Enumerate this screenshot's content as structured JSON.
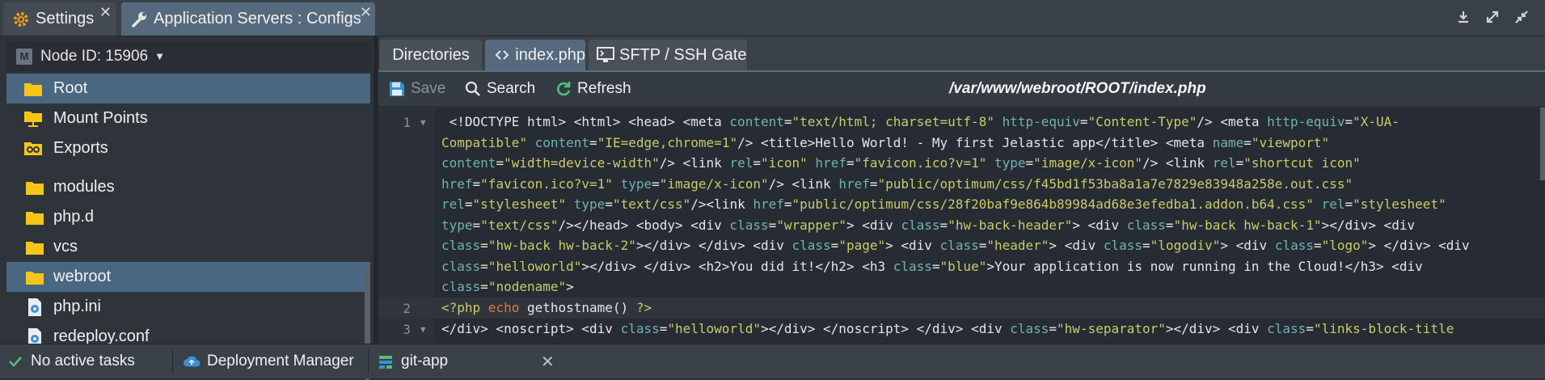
{
  "window_tabs": [
    {
      "label": "Settings",
      "icon": "gear-icon"
    },
    {
      "label": "Application Servers : Configs",
      "icon": "wrench-icon"
    }
  ],
  "node_selector": {
    "label": "Node ID: 15906",
    "badge": "M"
  },
  "tree": [
    {
      "label": "Root",
      "icon": "folder-icon"
    },
    {
      "label": "Mount Points",
      "icon": "mount-folder-icon"
    },
    {
      "label": "Exports",
      "icon": "exports-icon"
    },
    {
      "label": "modules",
      "icon": "folder-icon"
    },
    {
      "label": "php.d",
      "icon": "folder-icon"
    },
    {
      "label": "vcs",
      "icon": "folder-icon"
    },
    {
      "label": "webroot",
      "icon": "folder-icon"
    },
    {
      "label": "php.ini",
      "icon": "config-file-icon"
    },
    {
      "label": "redeploy.conf",
      "icon": "config-file-icon"
    }
  ],
  "editor_tabs": [
    {
      "label": "Directories"
    },
    {
      "label": "index.php"
    },
    {
      "label": "SFTP / SSH Gate"
    }
  ],
  "toolbar": {
    "save": "Save",
    "search": "Search",
    "refresh": "Refresh",
    "path": "/var/www/webroot/ROOT/index.php"
  },
  "code": {
    "line_numbers": [
      "1",
      "2",
      "3"
    ],
    "line1": [
      [
        [
          "t",
          " <!DOCTYPE html> <html> <head> <meta "
        ],
        [
          "a",
          "content"
        ],
        [
          "p",
          "="
        ],
        [
          "s",
          "\"text/html; charset=utf-8\""
        ],
        [
          "p",
          " "
        ],
        [
          "a",
          "http-equiv"
        ],
        [
          "p",
          "="
        ],
        [
          "s",
          "\"Content-Type\""
        ],
        [
          "t",
          "/> <meta "
        ],
        [
          "a",
          "http-equiv"
        ],
        [
          "p",
          "="
        ],
        [
          "s",
          "\"X-UA-"
        ]
      ],
      [
        [
          "s",
          "Compatible\""
        ],
        [
          "p",
          " "
        ],
        [
          "a",
          "content"
        ],
        [
          "p",
          "="
        ],
        [
          "s",
          "\"IE=edge,chrome=1\""
        ],
        [
          "t",
          "/> <title>Hello World! - My first Jelastic app</title> <meta "
        ],
        [
          "a",
          "name"
        ],
        [
          "p",
          "="
        ],
        [
          "s",
          "\"viewport\""
        ]
      ],
      [
        [
          "a",
          "content"
        ],
        [
          "p",
          "="
        ],
        [
          "s",
          "\"width=device-width\""
        ],
        [
          "t",
          "/> <link "
        ],
        [
          "a",
          "rel"
        ],
        [
          "p",
          "="
        ],
        [
          "s",
          "\"icon\""
        ],
        [
          "p",
          " "
        ],
        [
          "a",
          "href"
        ],
        [
          "p",
          "="
        ],
        [
          "s",
          "\"favicon.ico?v=1\""
        ],
        [
          "p",
          " "
        ],
        [
          "a",
          "type"
        ],
        [
          "p",
          "="
        ],
        [
          "s",
          "\"image/x-icon\""
        ],
        [
          "t",
          "/> <link "
        ],
        [
          "a",
          "rel"
        ],
        [
          "p",
          "="
        ],
        [
          "s",
          "\"shortcut icon\""
        ]
      ],
      [
        [
          "a",
          "href"
        ],
        [
          "p",
          "="
        ],
        [
          "s",
          "\"favicon.ico?v=1\""
        ],
        [
          "p",
          " "
        ],
        [
          "a",
          "type"
        ],
        [
          "p",
          "="
        ],
        [
          "s",
          "\"image/x-icon\""
        ],
        [
          "t",
          "/> <link "
        ],
        [
          "a",
          "href"
        ],
        [
          "p",
          "="
        ],
        [
          "s",
          "\"public/optimum/css/f45bd1f53ba8a1a7e7829e83948a258e.out.css\""
        ]
      ],
      [
        [
          "a",
          "rel"
        ],
        [
          "p",
          "="
        ],
        [
          "s",
          "\"stylesheet\""
        ],
        [
          "p",
          " "
        ],
        [
          "a",
          "type"
        ],
        [
          "p",
          "="
        ],
        [
          "s",
          "\"text/css\""
        ],
        [
          "t",
          "/><link "
        ],
        [
          "a",
          "href"
        ],
        [
          "p",
          "="
        ],
        [
          "s",
          "\"public/optimum/css/28f20baf9e864b89984ad68e3efedba1.addon.b64.css\""
        ],
        [
          "p",
          " "
        ],
        [
          "a",
          "rel"
        ],
        [
          "p",
          "="
        ],
        [
          "s",
          "\"stylesheet\""
        ]
      ],
      [
        [
          "a",
          "type"
        ],
        [
          "p",
          "="
        ],
        [
          "s",
          "\"text/css\""
        ],
        [
          "t",
          "/></head> <body> <div "
        ],
        [
          "a",
          "class"
        ],
        [
          "p",
          "="
        ],
        [
          "s",
          "\"wrapper\""
        ],
        [
          "t",
          "> <div "
        ],
        [
          "a",
          "class"
        ],
        [
          "p",
          "="
        ],
        [
          "s",
          "\"hw-back-header\""
        ],
        [
          "t",
          "> <div "
        ],
        [
          "a",
          "class"
        ],
        [
          "p",
          "="
        ],
        [
          "s",
          "\"hw-back hw-back-1\""
        ],
        [
          "t",
          "></div> <div"
        ]
      ],
      [
        [
          "a",
          "class"
        ],
        [
          "p",
          "="
        ],
        [
          "s",
          "\"hw-back hw-back-2\""
        ],
        [
          "t",
          "></div> </div> <div "
        ],
        [
          "a",
          "class"
        ],
        [
          "p",
          "="
        ],
        [
          "s",
          "\"page\""
        ],
        [
          "t",
          "> <div "
        ],
        [
          "a",
          "class"
        ],
        [
          "p",
          "="
        ],
        [
          "s",
          "\"header\""
        ],
        [
          "t",
          "> <div "
        ],
        [
          "a",
          "class"
        ],
        [
          "p",
          "="
        ],
        [
          "s",
          "\"logodiv\""
        ],
        [
          "t",
          "> <div "
        ],
        [
          "a",
          "class"
        ],
        [
          "p",
          "="
        ],
        [
          "s",
          "\"logo\""
        ],
        [
          "t",
          "> </div> <div"
        ]
      ],
      [
        [
          "a",
          "class"
        ],
        [
          "p",
          "="
        ],
        [
          "s",
          "\"helloworld\""
        ],
        [
          "t",
          "></div> </div> <h2>You did it!</h2> <h3 "
        ],
        [
          "a",
          "class"
        ],
        [
          "p",
          "="
        ],
        [
          "s",
          "\"blue\""
        ],
        [
          "t",
          ">Your application is now running in the Cloud!</h3> <div"
        ]
      ],
      [
        [
          "a",
          "class"
        ],
        [
          "p",
          "="
        ],
        [
          "s",
          "\"nodename\""
        ],
        [
          "t",
          ">"
        ]
      ]
    ],
    "line2": [
      [
        "s",
        "<?php "
      ],
      [
        "k",
        "echo"
      ],
      [
        "t",
        " gethostname() "
      ],
      [
        "s",
        "?>"
      ]
    ],
    "line3": [
      [
        "t",
        "</div> <noscript> <div "
      ],
      [
        "a",
        "class"
      ],
      [
        "p",
        "="
      ],
      [
        "s",
        "\"helloworld\""
      ],
      [
        "t",
        "></div> </noscript> </div> <div "
      ],
      [
        "a",
        "class"
      ],
      [
        "p",
        "="
      ],
      [
        "s",
        "\"hw-separator\""
      ],
      [
        "t",
        "></div> <div "
      ],
      [
        "a",
        "class"
      ],
      [
        "p",
        "="
      ],
      [
        "s",
        "\"links-block-title"
      ]
    ]
  },
  "statusbar": {
    "tasks": "No active tasks",
    "deployment_manager": "Deployment Manager",
    "app": "git-app"
  },
  "colors": {
    "selected": "#4a6782",
    "attribute": "#6fb3b3",
    "string": "#c8cc6a",
    "keyword": "#e07a3c",
    "accent_gear": "#f0a020",
    "folder": "#f5c518"
  }
}
